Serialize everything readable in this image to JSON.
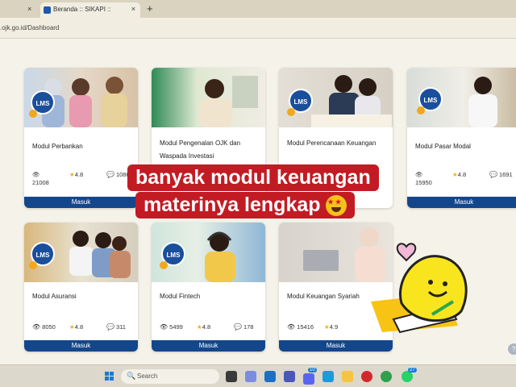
{
  "browser": {
    "tab_title": "Beranda :: SIKAPI ::",
    "tab_close": "×",
    "prev_tab_close": "×",
    "new_tab": "+",
    "url": ".ojk.go.id/Dashboard"
  },
  "badge_label": "LMS",
  "button_label": "Masuk",
  "modules": [
    {
      "title": "Modul Perbankan",
      "views": "21008",
      "rating": "4.8",
      "comments": "1086"
    },
    {
      "title": "Modul Pengenalan OJK dan Waspada Investasi",
      "views": "",
      "rating": "",
      "comments": ""
    },
    {
      "title": "Modul Perencanaan Keuangan",
      "views": "",
      "rating": "",
      "comments": ""
    },
    {
      "title": "Modul Pasar Modal",
      "views": "15950",
      "rating": "4.8",
      "comments": "1691"
    },
    {
      "title": "Modul Asuransi",
      "views": "8050",
      "rating": "4.8",
      "comments": "311"
    },
    {
      "title": "Modul Fintech",
      "views": "5499",
      "rating": "4.8",
      "comments": "178"
    },
    {
      "title": "Modul Keuangan Syariah",
      "views": "15416",
      "rating": "4.9",
      "comments": ""
    }
  ],
  "overlay": {
    "line1": "banyak modul keuangan",
    "line2": "materinya lengkap"
  },
  "taskbar": {
    "search_placeholder": "Search",
    "badge_teams": "10",
    "badge_whatsapp": "27"
  },
  "colors": {
    "brand_blue": "#14468c",
    "badge_blue": "#1a4f9c",
    "banner_red": "#c21b24",
    "star_yellow": "#f2b01e",
    "mascot_yellow": "#f9e51d"
  },
  "icons": [
    "eye-icon",
    "star-icon",
    "comment-icon",
    "search-icon",
    "heart-icon",
    "help-icon"
  ]
}
